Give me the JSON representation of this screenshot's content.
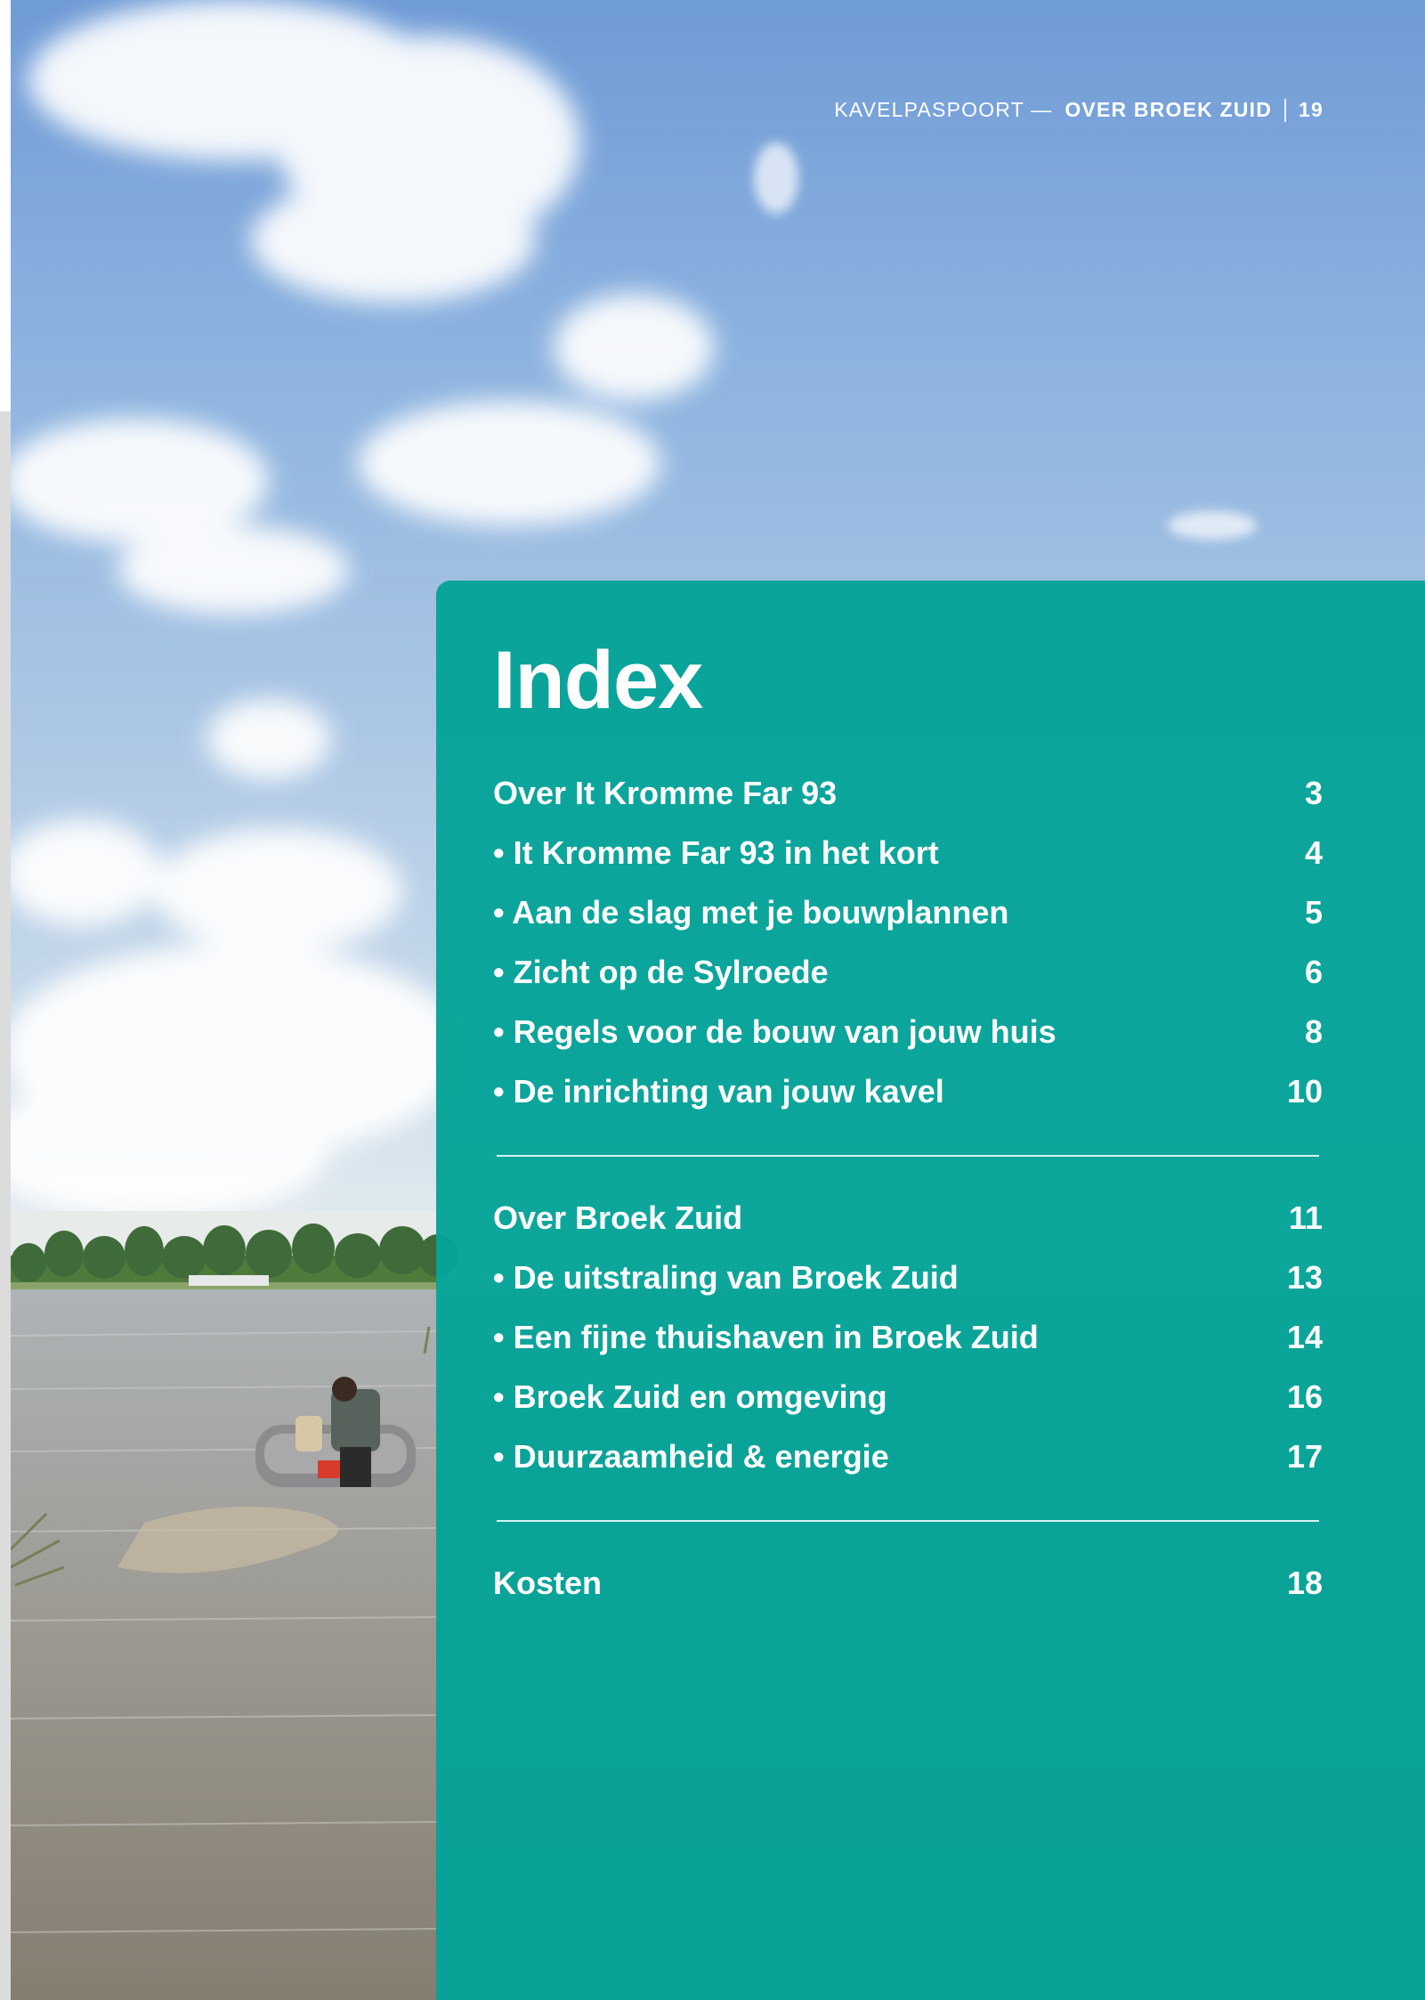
{
  "running_head": {
    "publication": "KAVELPASPOORT —",
    "section": "OVER BROEK ZUID",
    "page_number": "19"
  },
  "index": {
    "title": "Index",
    "groups": [
      {
        "heading": {
          "label": "Over It Kromme Far 93",
          "page": "3"
        },
        "items": [
          {
            "label": "• It Kromme Far 93 in het kort",
            "page": "4"
          },
          {
            "label": "• Aan de slag met je bouwplannen",
            "page": "5"
          },
          {
            "label": "• Zicht op de Sylroede",
            "page": "6"
          },
          {
            "label": "• Regels voor de bouw van jouw huis",
            "page": "8"
          },
          {
            "label": "• De inrichting van jouw kavel",
            "page": "10"
          }
        ]
      },
      {
        "heading": {
          "label": "Over Broek Zuid",
          "page": "11"
        },
        "items": [
          {
            "label": "• De uitstraling van Broek Zuid",
            "page": "13"
          },
          {
            "label": "• Een fijne thuishaven in Broek Zuid",
            "page": "14"
          },
          {
            "label": "• Broek Zuid en omgeving",
            "page": "16"
          },
          {
            "label": "• Duurzaamheid & energie",
            "page": "17"
          }
        ]
      },
      {
        "heading": {
          "label": "Kosten",
          "page": "18"
        },
        "items": []
      }
    ]
  },
  "colors": {
    "panel": "#05a398",
    "text": "#ffffff",
    "sky": "#6f9bd6",
    "water": "#8f8a80"
  },
  "photo": {
    "subject": "lake-with-rubber-boat-photo"
  }
}
